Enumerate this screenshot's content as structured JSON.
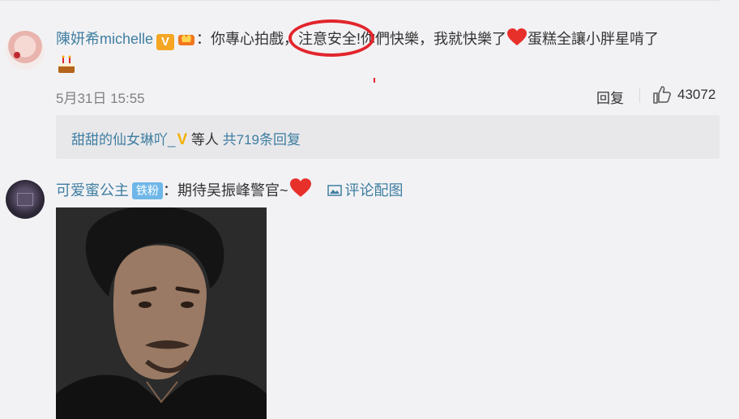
{
  "comment1": {
    "username": "陳妍希michelle",
    "text_before": "：你專心拍戲，",
    "circled_text": "注意安全!",
    "text_after": "你們快樂，我就快樂了",
    "text_end": "蛋糕全讓小胖星啃了",
    "time": "5月31日 15:55",
    "reply_label": "回复",
    "like_count": "43072",
    "replies": {
      "user": "甜甜的仙女琳吖_",
      "suffix": "等人",
      "count_text": "共719条回复"
    }
  },
  "comment2": {
    "username": "可爱蜜公主",
    "fan_badge": "铁粉",
    "text": "：期待吴振峰警官~",
    "image_link": "评论配图"
  },
  "colors": {
    "link": "#3f7ea0",
    "annotation_red": "#e2252c",
    "verified_orange": "#f5a623",
    "fan_blue": "#6fb7e8"
  },
  "icons": [
    "verified-v-icon",
    "crown-badge-icon",
    "heart-icon",
    "cake-icon",
    "thumbs-up-icon",
    "image-icon"
  ]
}
